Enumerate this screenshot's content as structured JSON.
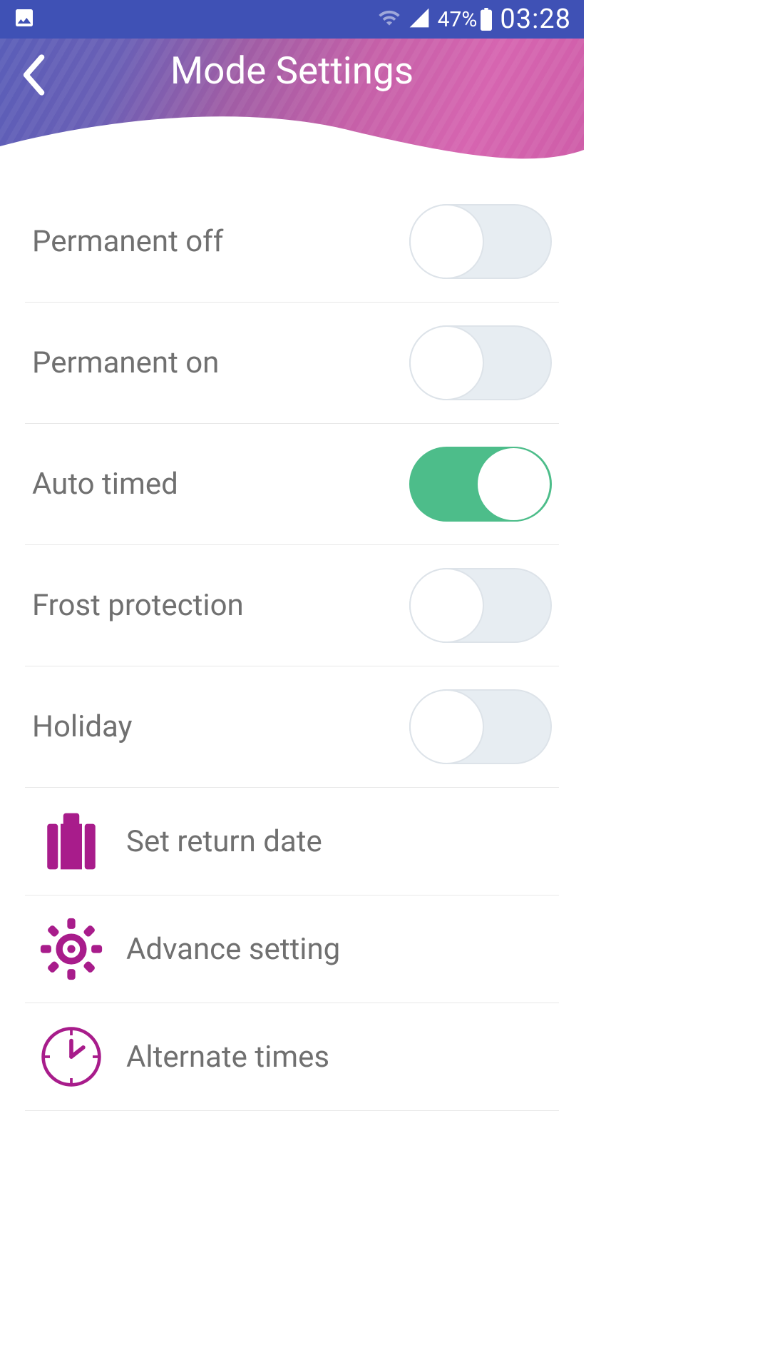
{
  "status_bar": {
    "battery_percent": "47%",
    "time": "03:28"
  },
  "header": {
    "title": "Mode Settings"
  },
  "toggles": {
    "permanent_off": {
      "label": "Permanent off",
      "state": "off"
    },
    "permanent_on": {
      "label": "Permanent on",
      "state": "off"
    },
    "auto_timed": {
      "label": "Auto timed",
      "state": "on"
    },
    "frost_protection": {
      "label": "Frost protection",
      "state": "off"
    },
    "holiday": {
      "label": "Holiday",
      "state": "off"
    }
  },
  "actions": {
    "return_date": {
      "label": "Set return date",
      "icon": "suitcase-icon"
    },
    "advance_setting": {
      "label": "Advance setting",
      "icon": "gear-icon"
    },
    "alternate_times": {
      "label": "Alternate times",
      "icon": "clock-icon"
    }
  },
  "colors": {
    "accent": "#a81c8b",
    "toggle_on": "#4dbd8a",
    "status_bar_bg": "#3f51b5"
  }
}
